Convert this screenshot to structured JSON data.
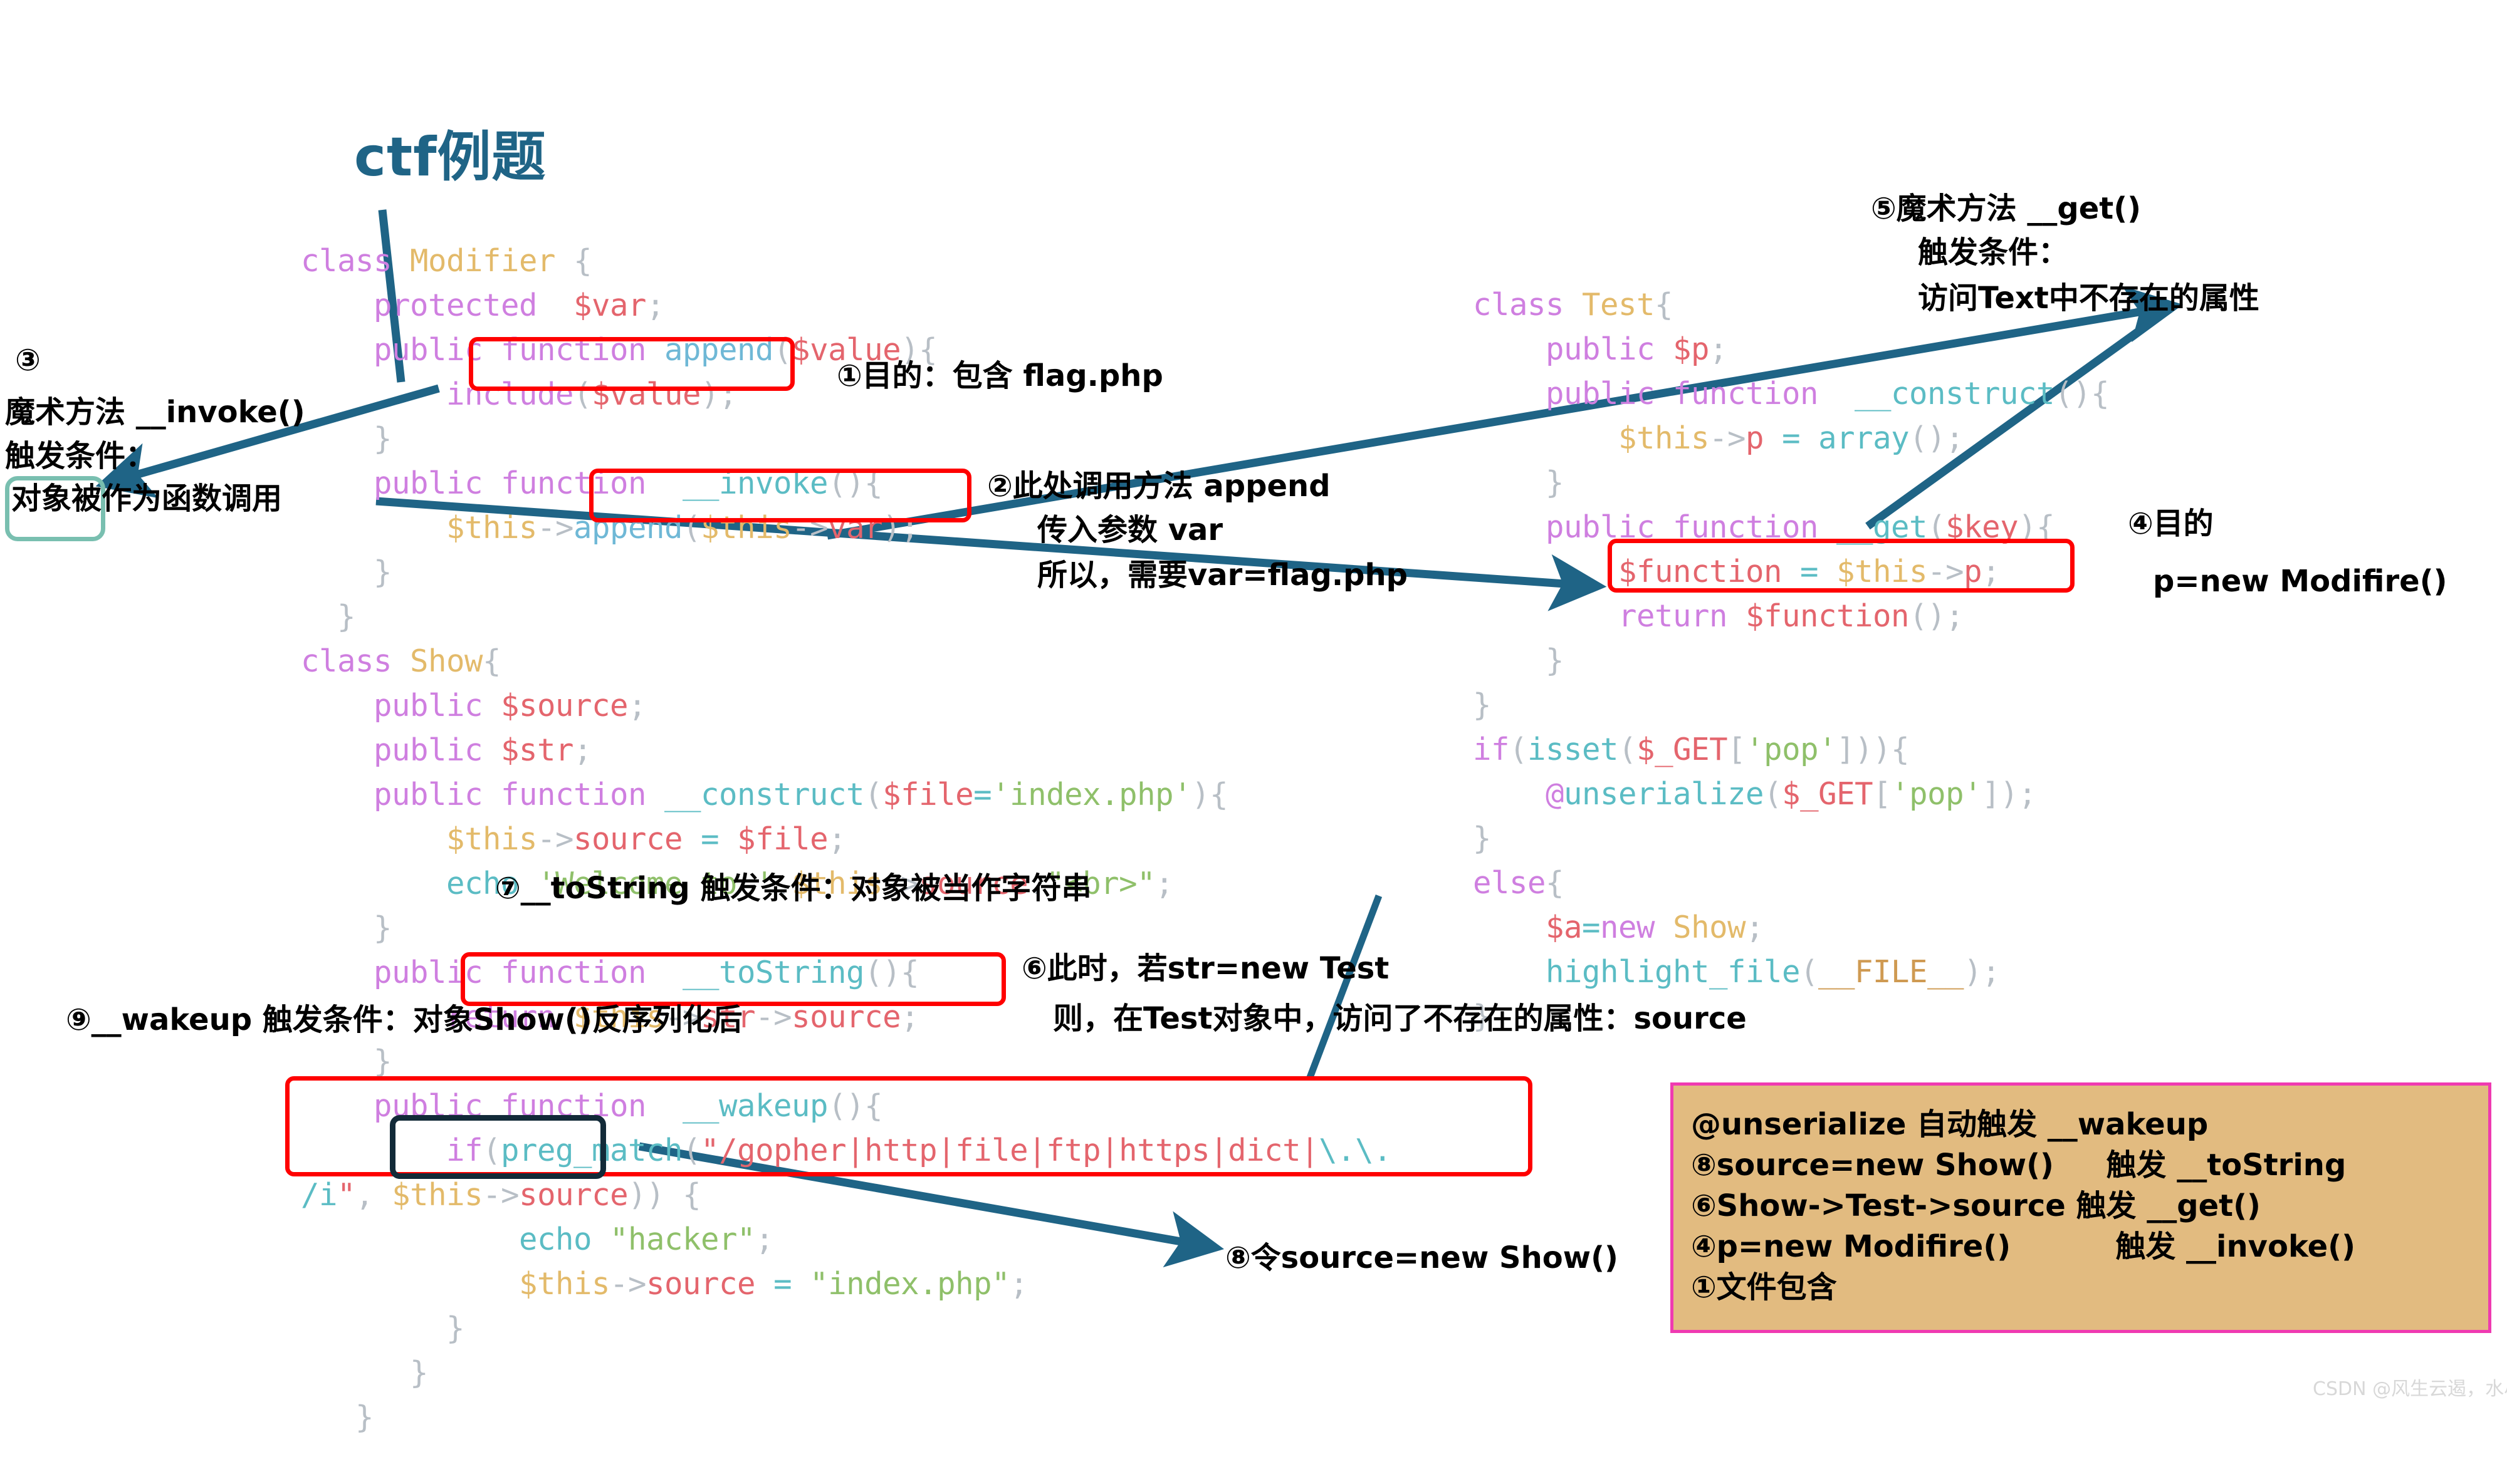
{
  "title": "ctf例题",
  "colors": {
    "title": "#1f6486",
    "arrow": "#1f6486",
    "redbox": "#ff0000",
    "tealbox": "#79bfb0",
    "darkbox": "#122a38",
    "summary_bg": "#e2bb80",
    "summary_border": "#ef3ab1"
  },
  "code_left": {
    "lines": [
      "class Modifier {",
      "    protected  $var;",
      "    public function append($value){",
      "        include($value);",
      "    }",
      "    public function  __invoke(){",
      "        $this->append($this->var);",
      "    }",
      "}",
      "class Show{",
      "    public $source;",
      "    public $str;",
      "    public function __construct($file='index.php'){",
      "        $this->source = $file;",
      "        echo 'Welcome to '.$this->source.\"<br>\";",
      "    }",
      "    public function __toString(){",
      "        return $this->str->source;",
      "    }",
      "    public function __wakeup(){",
      "        if(preg_match(\"/gopher|http|file|ftp|https|dict|\\.\\.",
      "/i\", $this->source)) {",
      "            echo \"hacker\";",
      "            $this->source = \"index.php\";",
      "        }",
      "    }",
      "}"
    ]
  },
  "code_right": {
    "lines": [
      "class Test{",
      "    public $p;",
      "    public function  __construct(){",
      "        $this->p = array();",
      "    }",
      "    public function __get($key){",
      "        $function = $this->p;",
      "        return $function();",
      "    }",
      "}",
      "if(isset($_GET['pop'])){",
      "    @unserialize($_GET['pop']);",
      "}",
      "else{",
      "    $a=new Show;",
      "    highlight_file(__FILE__);",
      "}"
    ]
  },
  "annotations": {
    "a1": "①目的：包含 flag.php",
    "a2_l1": "②此处调用方法 append",
    "a2_l2": "传入参数 var",
    "a2_l3": "所以，需要var=flag.php",
    "a3_l1": "③",
    "a3_l2": "魔术方法 __invoke()",
    "a3_l3": "触发条件：",
    "a3_l4": "对象被作为函数调用",
    "a4_l1": "④目的",
    "a4_l2": "p=new Modifire()",
    "a5_l1": "⑤魔术方法 __get()",
    "a5_l2": "触发条件：",
    "a5_l3": "访问Text中不存在的属性",
    "a6_l1": "⑥此时，若str=new Test",
    "a6_l2": "则，在Test对象中，访问了不存在的属性：source",
    "a7": "⑦__toString 触发条件：对象被当作字符串",
    "a8": "⑧令source=new Show()",
    "a9": "⑨__wakeup 触发条件：对象Show()反序列化后"
  },
  "summary": {
    "lines": [
      "@unserialize 自动触发 __wakeup",
      "⑧source=new Show()     触发 __toString",
      "⑥Show->Test->source 触发 __get()",
      "④p=new Modifire()          触发 __invoke()",
      "①文件包含"
    ]
  },
  "watermark": "CSDN @风生云遏，水尽潭清"
}
